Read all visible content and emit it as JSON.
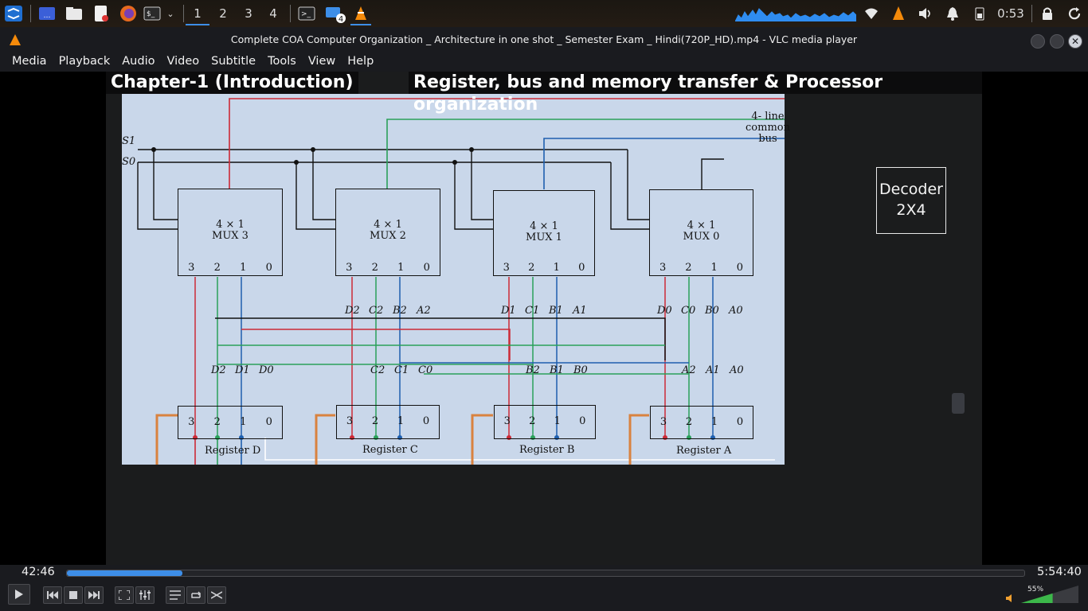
{
  "taskbar": {
    "workspaces": [
      "1",
      "2",
      "3",
      "4"
    ],
    "active_workspace": "1",
    "files_badge": "4",
    "clock": "0:53",
    "icons": [
      "kde-app-menu-icon",
      "desktop-icon",
      "file-manager-icon",
      "text-editor-icon",
      "firefox-icon",
      "terminal-icon",
      "chevron-down-icon",
      "terminal-icon",
      "files-icon",
      "vlc-icon",
      "wifi-icon",
      "vlc-tray-icon",
      "volume-icon",
      "bell-icon",
      "battery-icon",
      "lock-icon",
      "refresh-icon"
    ]
  },
  "window": {
    "title": "Complete COA Computer Organization _ Architecture in one shot _ Semester Exam _ Hindi(720P_HD).mp4 - VLC media player"
  },
  "menu": [
    "Media",
    "Playback",
    "Audio",
    "Video",
    "Subtitle",
    "Tools",
    "View",
    "Help"
  ],
  "video": {
    "caption_left": "Chapter-1 (Introduction)",
    "caption_right": "Register, bus and memory transfer & Processor organization",
    "bus_label_1": "4- line",
    "bus_label_2": "common",
    "bus_label_3": "bus",
    "select_s1": "S1",
    "select_s0": "S0",
    "mux_type": "4 × 1",
    "muxes": [
      "MUX 3",
      "MUX 2",
      "MUX 1",
      "MUX 0"
    ],
    "ports": [
      "3",
      "2",
      "1",
      "0"
    ],
    "registers": [
      "Register D",
      "Register C",
      "Register B",
      "Register A"
    ],
    "mux_inputs": [
      [
        "D2",
        "C2",
        "B2",
        "A2"
      ],
      [
        "D1",
        "C1",
        "B1",
        "A1"
      ],
      [
        "D0",
        "C0",
        "B0",
        "A0"
      ]
    ],
    "reg_outputs": [
      [
        "D2",
        "D1",
        "D0"
      ],
      [
        "C2",
        "C1",
        "C0"
      ],
      [
        "B2",
        "B1",
        "B0"
      ],
      [
        "A2",
        "A1",
        "A0"
      ]
    ],
    "decoder_line1": "Decoder",
    "decoder_line2": "2X4",
    "colors": {
      "red": "#cc2a36",
      "green": "#2aa05a",
      "blue": "#1f5fae",
      "orange": "#d9823f"
    }
  },
  "controls": {
    "elapsed": "42:46",
    "total": "5:54:40",
    "progress": 0.121,
    "volume_label": "55%",
    "volume": 0.55,
    "accent": "#3d8ee8"
  }
}
